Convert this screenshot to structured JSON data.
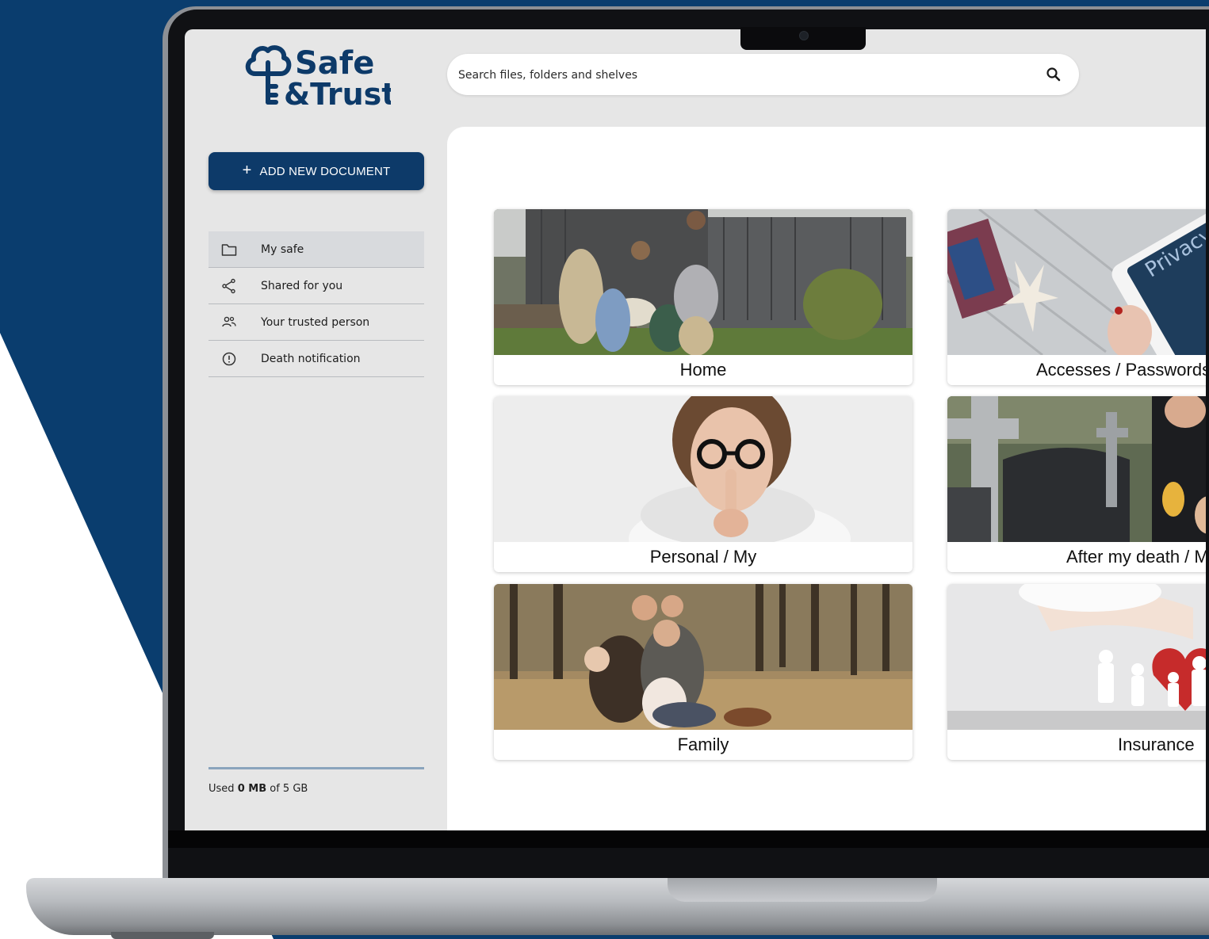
{
  "app": {
    "brand_line1": "Safe",
    "brand_line2": "&Trust",
    "brand_color": "#0d3a69",
    "accent_color": "#0d3a69"
  },
  "search": {
    "placeholder": "Search files, folders and shelves",
    "icon": "search-icon"
  },
  "sidebar": {
    "add_button": {
      "icon": "plus-icon",
      "label": "ADD NEW DOCUMENT"
    },
    "items": [
      {
        "icon": "folder-icon",
        "label": "My safe",
        "active": true
      },
      {
        "icon": "share-icon",
        "label": "Shared for you",
        "active": false
      },
      {
        "icon": "people-icon",
        "label": "Your trusted person",
        "active": false
      },
      {
        "icon": "alert-circle-icon",
        "label": "Death notification",
        "active": false
      }
    ],
    "storage": {
      "prefix": "Used",
      "used": "0 MB",
      "suffix": "of 5 GB"
    }
  },
  "categories": [
    {
      "label": "Home"
    },
    {
      "label": "Accesses / Passwords"
    },
    {
      "label": "Personal / My"
    },
    {
      "label": "After my death / M"
    },
    {
      "label": "Family"
    },
    {
      "label": "Insurance"
    }
  ]
}
